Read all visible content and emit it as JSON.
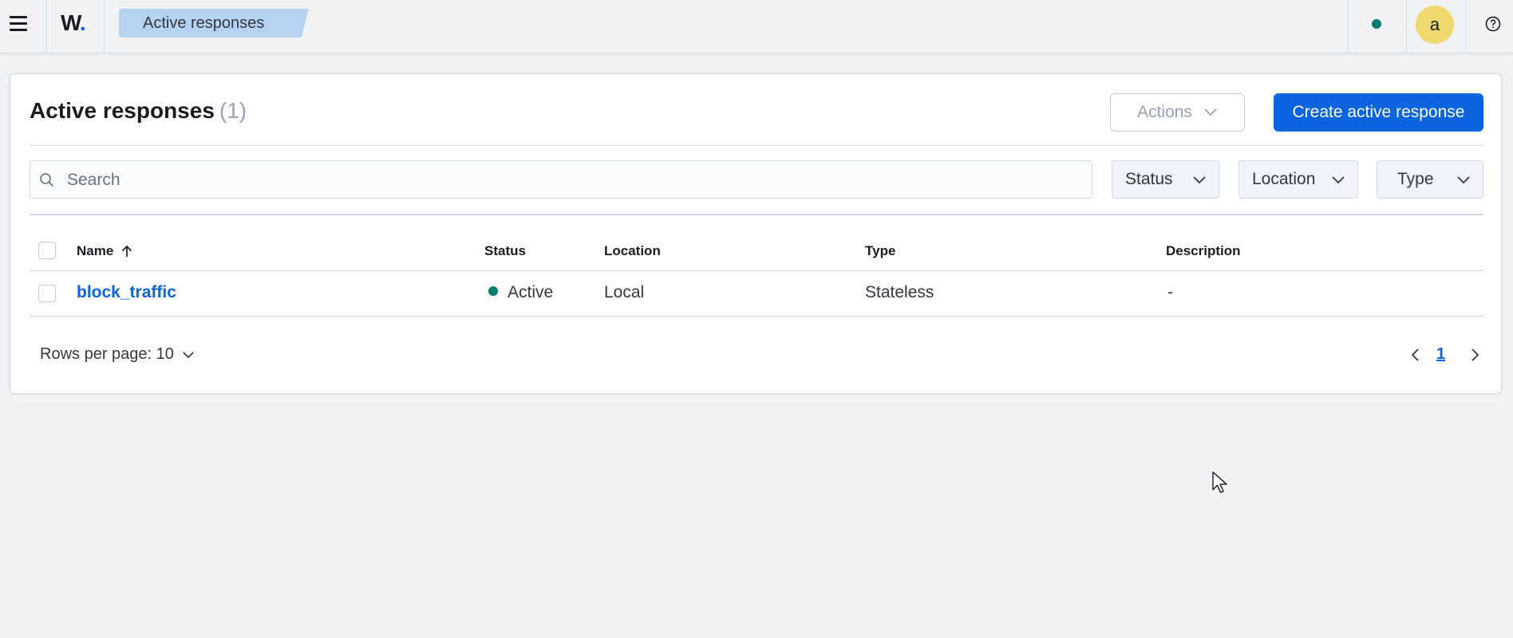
{
  "header": {
    "logo_text": "W",
    "logo_dot": ".",
    "breadcrumb": "Active responses",
    "avatar_initial": "a",
    "health_color": "#017d73",
    "accent_color": "#0b64dd"
  },
  "panel": {
    "title": "Active responses",
    "count": "(1)",
    "actions_label": "Actions",
    "create_label": "Create active response",
    "search_placeholder": "Search",
    "filters": {
      "status": "Status",
      "location": "Location",
      "type": "Type"
    }
  },
  "table": {
    "columns": {
      "name": "Name",
      "status": "Status",
      "location": "Location",
      "type": "Type",
      "description": "Description"
    },
    "rows": [
      {
        "name": "block_traffic",
        "status": "Active",
        "location": "Local",
        "type": "Stateless",
        "description": "-"
      }
    ]
  },
  "footer": {
    "rows_per_page": "Rows per page: 10",
    "current_page": "1"
  }
}
